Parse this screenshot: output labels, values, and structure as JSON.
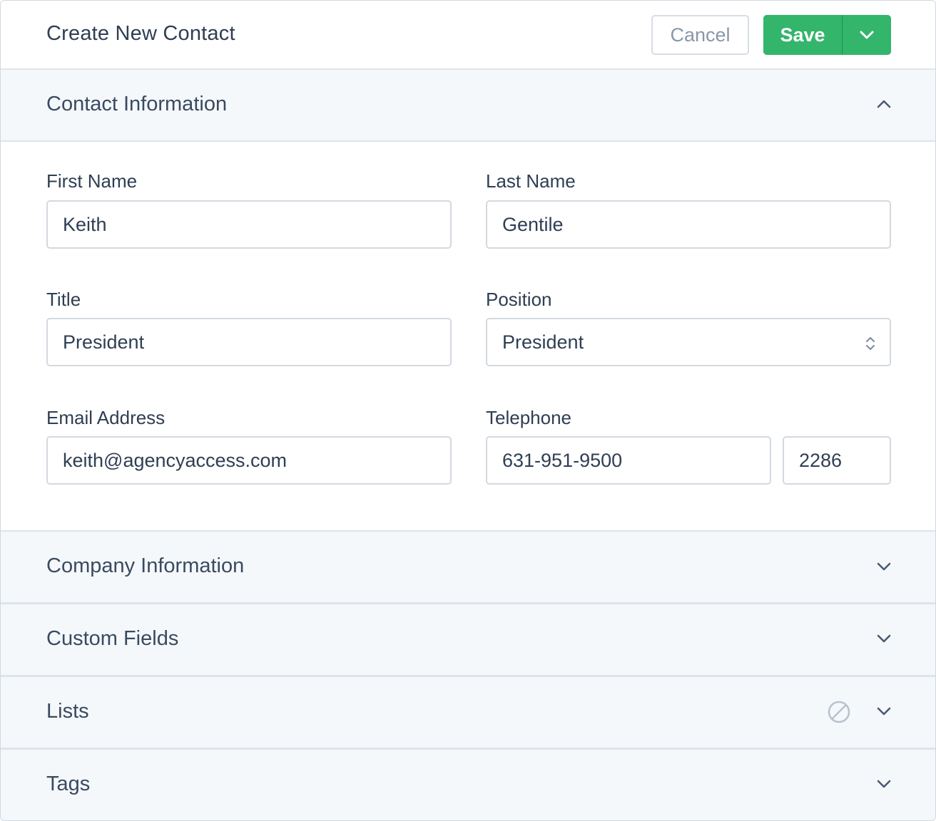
{
  "header": {
    "title": "Create New Contact",
    "cancel_label": "Cancel",
    "save_label": "Save"
  },
  "sections": {
    "contact_information": "Contact Information",
    "company_information": "Company Information",
    "custom_fields": "Custom Fields",
    "lists": "Lists",
    "tags": "Tags"
  },
  "form": {
    "first_name": {
      "label": "First Name",
      "value": "Keith"
    },
    "last_name": {
      "label": "Last Name",
      "value": "Gentile"
    },
    "title": {
      "label": "Title",
      "value": "President"
    },
    "position": {
      "label": "Position",
      "value": "President"
    },
    "email": {
      "label": "Email Address",
      "value": "keith@agencyaccess.com"
    },
    "telephone": {
      "label": "Telephone",
      "value": "631-951-9500",
      "extension": "2286"
    }
  },
  "colors": {
    "save_green": "#33b56b",
    "section_bg": "#f5f8fb",
    "text": "#2f3e53"
  }
}
